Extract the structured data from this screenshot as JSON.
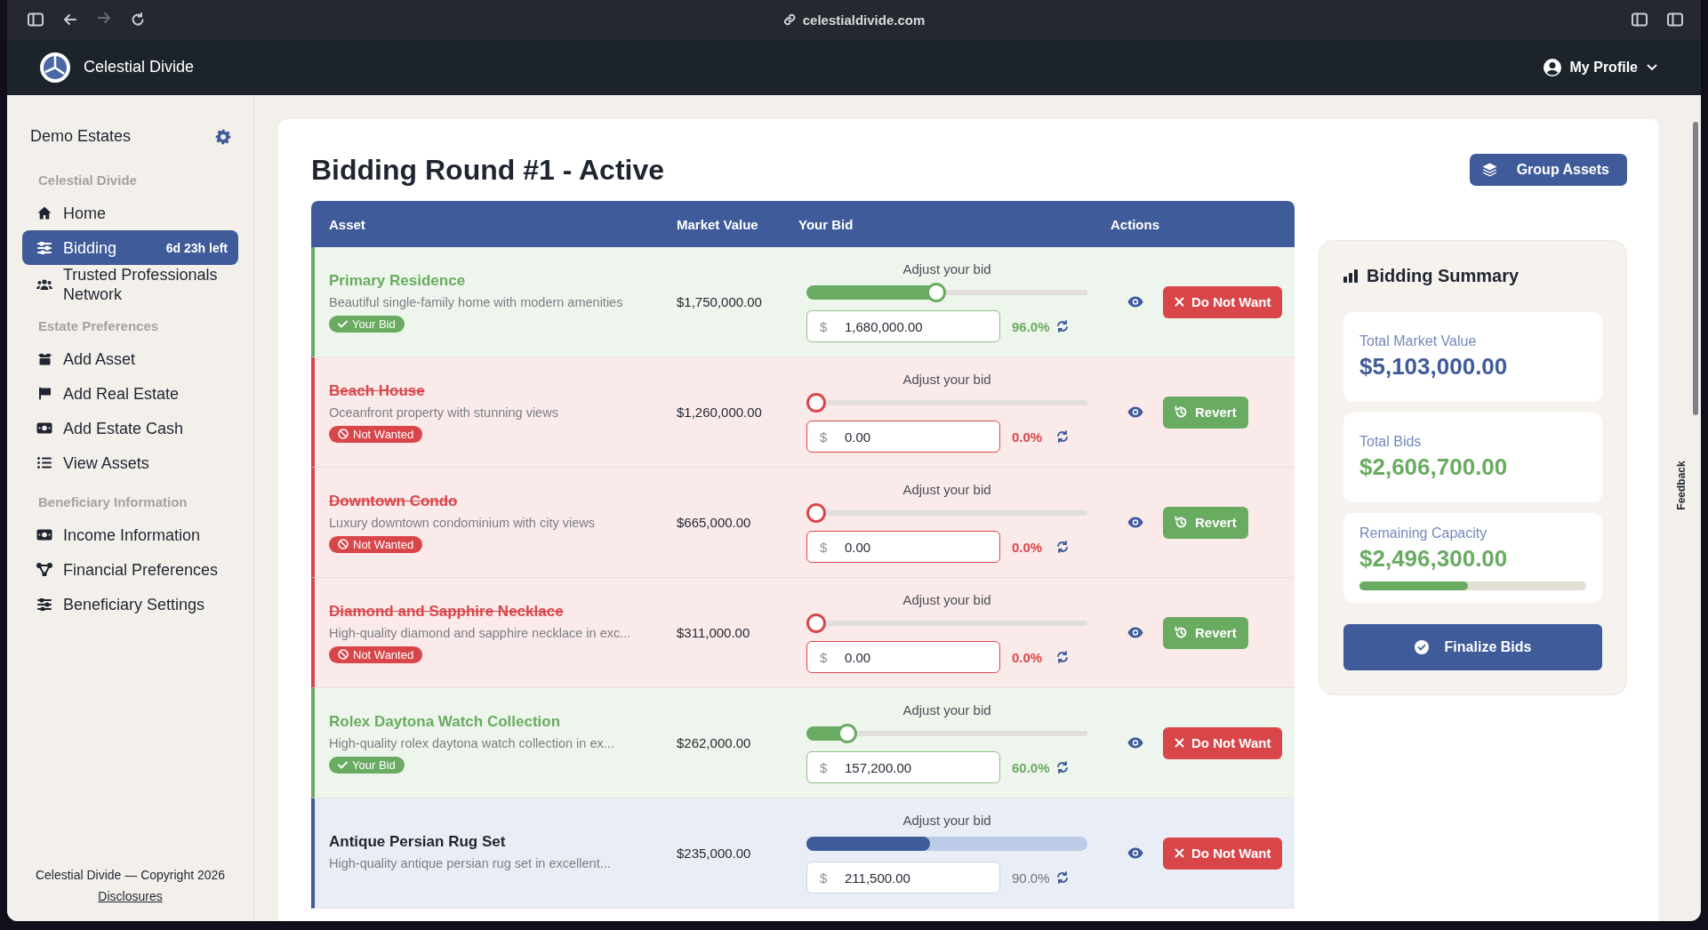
{
  "browser": {
    "url": "celestialdivide.com"
  },
  "header": {
    "brand": "Celestial Divide",
    "profile": "My Profile"
  },
  "sidebar": {
    "workspace": "Demo Estates",
    "sections": [
      {
        "heading": "Celestial Divide",
        "items": [
          {
            "label": "Home",
            "selected": false
          },
          {
            "label": "Bidding",
            "selected": true,
            "badge": "6d 23h left"
          },
          {
            "label": "Trusted Professionals Network",
            "selected": false
          }
        ]
      },
      {
        "heading": "Estate Preferences",
        "items": [
          {
            "label": "Add Asset",
            "selected": false
          },
          {
            "label": "Add Real Estate",
            "selected": false
          },
          {
            "label": "Add Estate Cash",
            "selected": false
          },
          {
            "label": "View Assets",
            "selected": false
          }
        ]
      },
      {
        "heading": "Beneficiary Information",
        "items": [
          {
            "label": "Income Information",
            "selected": false
          },
          {
            "label": "Financial Preferences",
            "selected": false
          },
          {
            "label": "Beneficiary Settings",
            "selected": false
          }
        ]
      }
    ],
    "footer": "Celestial Divide — Copyright 2026",
    "footer_link": "Disclosures"
  },
  "page": {
    "title": "Bidding Round #1 - Active",
    "group_button": "Group Assets"
  },
  "table": {
    "columns": [
      "Asset",
      "Market Value",
      "Your Bid",
      "Actions"
    ],
    "rows": [
      {
        "name": "Primary Residence",
        "description": "Beautiful single-family home with modern amenities",
        "kind": "wanted",
        "badge": "Your Bid",
        "market_value": "$1,750,000.00",
        "bid_label": "Adjust your bid",
        "level": 0.46,
        "currency": "$",
        "bid": "1,680,000.00",
        "percent": "96.0%",
        "action": "Do Not Want"
      },
      {
        "name": "Beach House",
        "description": "Oceanfront property with stunning views",
        "kind": "not_wanted",
        "badge": "Not Wanted",
        "market_value": "$1,260,000.00",
        "bid_label": "Adjust your bid",
        "level": 0,
        "currency": "$",
        "bid": "0.00",
        "percent": "0.0%",
        "action": "Revert"
      },
      {
        "name": "Downtown Condo",
        "description": "Luxury downtown condominium with city views",
        "kind": "not_wanted",
        "badge": "Not Wanted",
        "market_value": "$665,000.00",
        "bid_label": "Adjust your bid",
        "level": 0,
        "currency": "$",
        "bid": "0.00",
        "percent": "0.0%",
        "action": "Revert"
      },
      {
        "name": "Diamond and Sapphire Necklace",
        "description": "High-quality diamond and sapphire necklace in exc...",
        "kind": "not_wanted",
        "badge": "Not Wanted",
        "market_value": "$311,000.00",
        "bid_label": "Adjust your bid",
        "level": 0,
        "currency": "$",
        "bid": "0.00",
        "percent": "0.0%",
        "action": "Revert"
      },
      {
        "name": "Rolex Daytona Watch Collection",
        "description": "High-quality rolex daytona watch collection in ex...",
        "kind": "wanted",
        "badge": "Your Bid",
        "market_value": "$262,000.00",
        "bid_label": "Adjust your bid",
        "level": 0.12,
        "currency": "$",
        "bid": "157,200.00",
        "percent": "60.0%",
        "action": "Do Not Want"
      },
      {
        "name": "Antique Persian Rug Set",
        "description": "High-quality antique persian rug set in excellent...",
        "kind": "neutral",
        "market_value": "$235,000.00",
        "bid_label": "Adjust your bid",
        "level": 0.44,
        "currency": "$",
        "bid": "211,500.00",
        "percent": "90.0%",
        "action": "Do Not Want"
      }
    ]
  },
  "summary": {
    "title": "Bidding Summary",
    "stats": [
      {
        "label": "Total Market Value",
        "value": "$5,103,000.00",
        "color": "#3f5b9a"
      },
      {
        "label": "Total Bids",
        "value": "$2,606,700.00",
        "color": "#6aab62"
      },
      {
        "label": "Remaining Capacity",
        "value": "$2,496,300.00",
        "color": "#6aab62",
        "level": 0.48
      }
    ],
    "button": "Finalize Bids"
  },
  "feedback": "Feedback"
}
